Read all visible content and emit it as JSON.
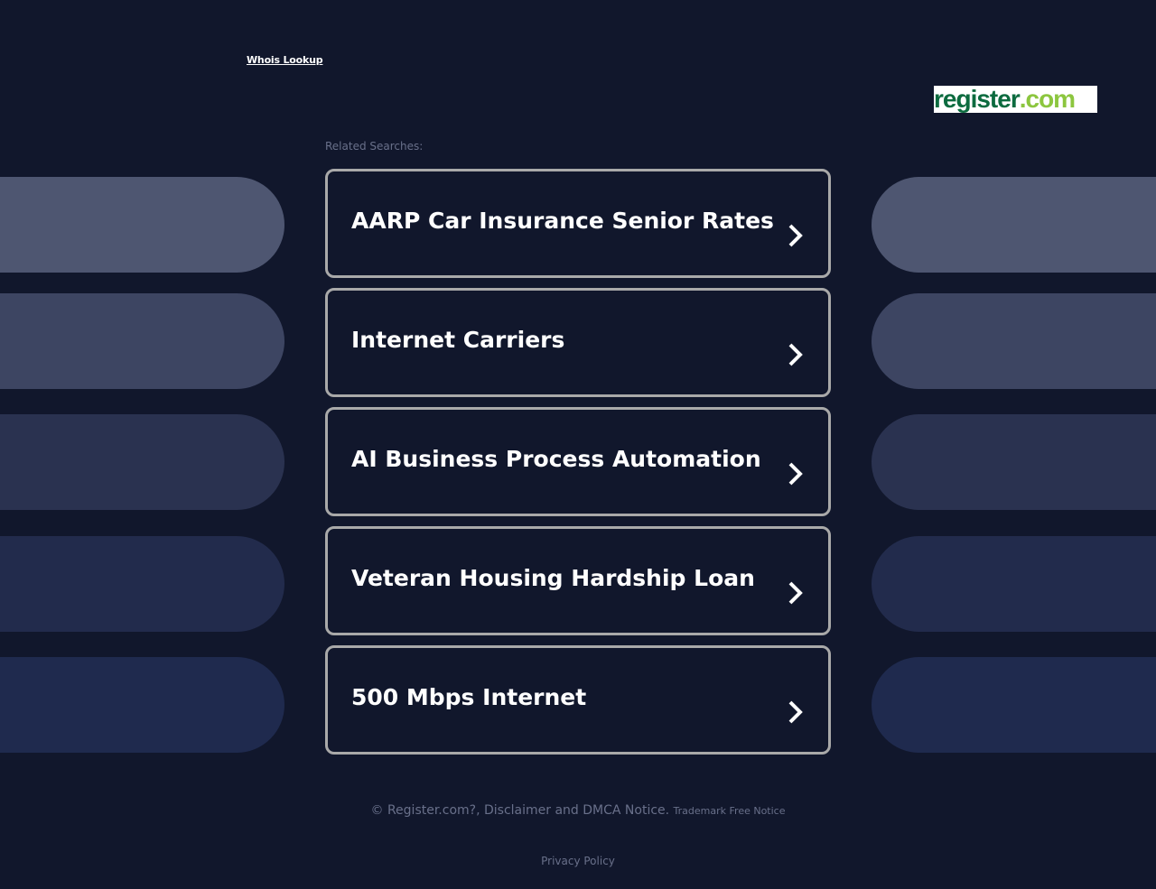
{
  "header": {
    "whois_link": "Whois Lookup",
    "logo": {
      "main": "register",
      "dot": ".",
      "tld": "com",
      "brand_color": "#0c6b3f",
      "accent_color": "#8cc63f"
    }
  },
  "related": {
    "label": "Related Searches:",
    "items": [
      {
        "label": "AARP Car Insurance Senior Rates"
      },
      {
        "label": "Internet Carriers"
      },
      {
        "label": "AI Business Process Automation"
      },
      {
        "label": "Veteran Housing Hardship Loan"
      },
      {
        "label": "500 Mbps Internet"
      }
    ]
  },
  "footer": {
    "notice": "© Register.com?, Disclaimer and DMCA Notice.",
    "trademark": "Trademark Free Notice",
    "privacy": "Privacy Policy"
  },
  "colors": {
    "background": "#11172c",
    "card_border": "#a9a9a9",
    "muted_text": "#69708a"
  }
}
